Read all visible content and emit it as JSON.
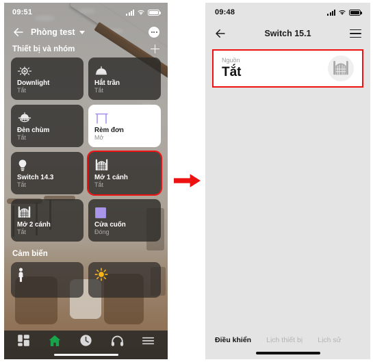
{
  "left_phone": {
    "status_bar": {
      "time": "09:51",
      "signal_icon": "signal-bars-icon",
      "wifi_icon": "wifi-icon",
      "battery_icon": "battery-icon"
    },
    "nav": {
      "back_icon": "back-arrow-icon",
      "room_title": "Phòng test",
      "caret_icon": "chevron-down-icon",
      "more_icon": "more-options-icon"
    },
    "devices_section": {
      "title": "Thiết bị và nhóm",
      "add_icon": "plus-icon"
    },
    "devices": [
      {
        "name": "Downlight",
        "state": "Tắt",
        "icon": "downlight-icon",
        "active": false,
        "selected": false
      },
      {
        "name": "Hắt trần",
        "state": "Tắt",
        "icon": "ceiling-light-icon",
        "active": false,
        "selected": false
      },
      {
        "name": "Đèn chùm",
        "state": "Tắt",
        "icon": "chandelier-icon",
        "active": false,
        "selected": false
      },
      {
        "name": "Rèm đơn",
        "state": "Mở",
        "icon": "curtain-icon",
        "active": true,
        "selected": false
      },
      {
        "name": "Switch 14.3",
        "state": "Tắt",
        "icon": "bulb-icon",
        "active": false,
        "selected": false
      },
      {
        "name": "Mở 1 cánh",
        "state": "Tắt",
        "icon": "gate-icon",
        "active": false,
        "selected": true
      },
      {
        "name": "Mở 2 cánh",
        "state": "Tắt",
        "icon": "gate-icon",
        "active": false,
        "selected": false
      },
      {
        "name": "Cửa cuốn",
        "state": "Đóng",
        "icon": "roller-shutter-icon",
        "active": false,
        "selected": false
      }
    ],
    "sensors_section": {
      "title": "Cảm biến"
    },
    "sensors": [
      {
        "icon": "motion-sensor-icon"
      },
      {
        "icon": "light-sensor-icon"
      }
    ],
    "tabbar": [
      {
        "icon": "dashboard-icon",
        "active": false
      },
      {
        "icon": "home-icon",
        "active": true
      },
      {
        "icon": "clock-icon",
        "active": false
      },
      {
        "icon": "headphones-icon",
        "active": false
      },
      {
        "icon": "menu-icon",
        "active": false
      }
    ]
  },
  "arrow": {
    "icon": "right-arrow-icon",
    "color": "#ee1111"
  },
  "right_phone": {
    "status_bar": {
      "time": "09:48",
      "signal_icon": "signal-bars-icon",
      "wifi_icon": "wifi-icon",
      "battery_icon": "battery-icon"
    },
    "nav": {
      "back_icon": "back-arrow-icon",
      "title": "Switch 15.1",
      "menu_icon": "hamburger-menu-icon"
    },
    "power_card": {
      "label": "Nguồn",
      "value": "Tắt",
      "icon": "gate-icon",
      "highlight_color": "#ee1111"
    },
    "tabs": [
      {
        "label": "Điều khiển",
        "active": true
      },
      {
        "label": "Lịch thiết bị",
        "active": false
      },
      {
        "label": "Lịch sử",
        "active": false
      }
    ]
  },
  "colors": {
    "highlight": "#ee1111",
    "tile_inactive": "rgba(44,42,40,0.80)",
    "tile_active": "#ffffff",
    "accent_purple": "#a996ea",
    "nav_active_green": "#18a44a",
    "sun_yellow": "#f5b417"
  }
}
